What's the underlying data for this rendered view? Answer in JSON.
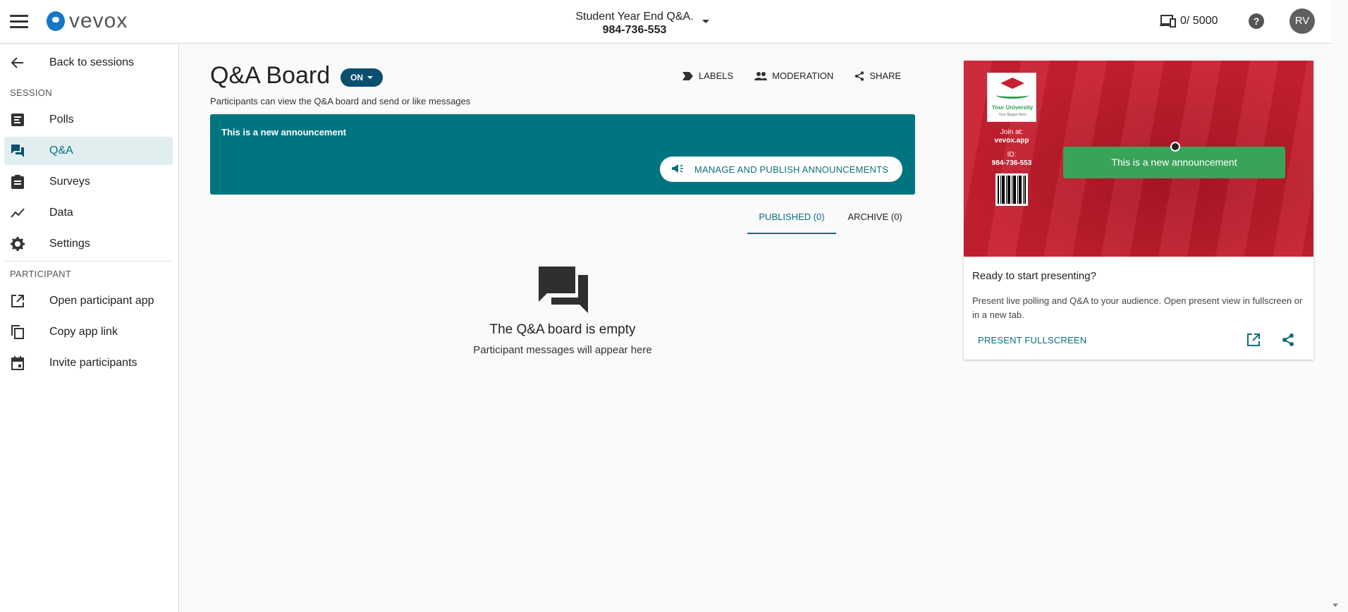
{
  "header": {
    "logo_text": "vevox",
    "session_name": "Student Year End Q&A.",
    "session_code": "984-736-553",
    "devices_count": "0/ 5000",
    "help_label": "?",
    "avatar_initials": "RV"
  },
  "sidebar": {
    "back_label": "Back to sessions",
    "session_section": "SESSION",
    "items": [
      {
        "label": "Polls",
        "icon": "polls-icon"
      },
      {
        "label": "Q&A",
        "icon": "qa-icon"
      },
      {
        "label": "Surveys",
        "icon": "surveys-icon"
      },
      {
        "label": "Data",
        "icon": "data-icon"
      },
      {
        "label": "Settings",
        "icon": "gear-icon"
      }
    ],
    "participant_section": "PARTICIPANT",
    "participant_items": [
      {
        "label": "Open participant app",
        "icon": "open-external-icon"
      },
      {
        "label": "Copy app link",
        "icon": "copy-icon"
      },
      {
        "label": "Invite participants",
        "icon": "calendar-icon"
      }
    ]
  },
  "main": {
    "title": "Q&A Board",
    "toggle_label": "ON",
    "subtitle": "Participants can view the Q&A board and send or like messages",
    "actions": {
      "labels": "LABELS",
      "moderation": "MODERATION",
      "share": "SHARE"
    },
    "announcement": {
      "text": "This is a new announcement",
      "manage_label": "MANAGE AND PUBLISH ANNOUNCEMENTS"
    },
    "tabs": {
      "published": "PUBLISHED (0)",
      "archive": "ARCHIVE (0)"
    },
    "empty": {
      "title": "The Q&A board is empty",
      "subtitle": "Participant messages will appear here"
    }
  },
  "present_card": {
    "preview": {
      "university_name": "Your University",
      "university_slogan": "Your Slogan Here",
      "join_label": "Join at:",
      "join_url": "vevox.app",
      "id_label": "ID:",
      "id_value": "984-736-553",
      "announcement": "This is a new announcement"
    },
    "title": "Ready to start presenting?",
    "description": "Present live polling and Q&A to your audience. Open present view in fullscreen or in a new tab.",
    "present_label": "PRESENT FULLSCREEN"
  },
  "colors": {
    "teal": "#007580",
    "accent_text": "#0a6e7e",
    "toggle": "#0a4f6e",
    "preview_red": "#c8202f",
    "preview_green": "#3aa35a"
  }
}
